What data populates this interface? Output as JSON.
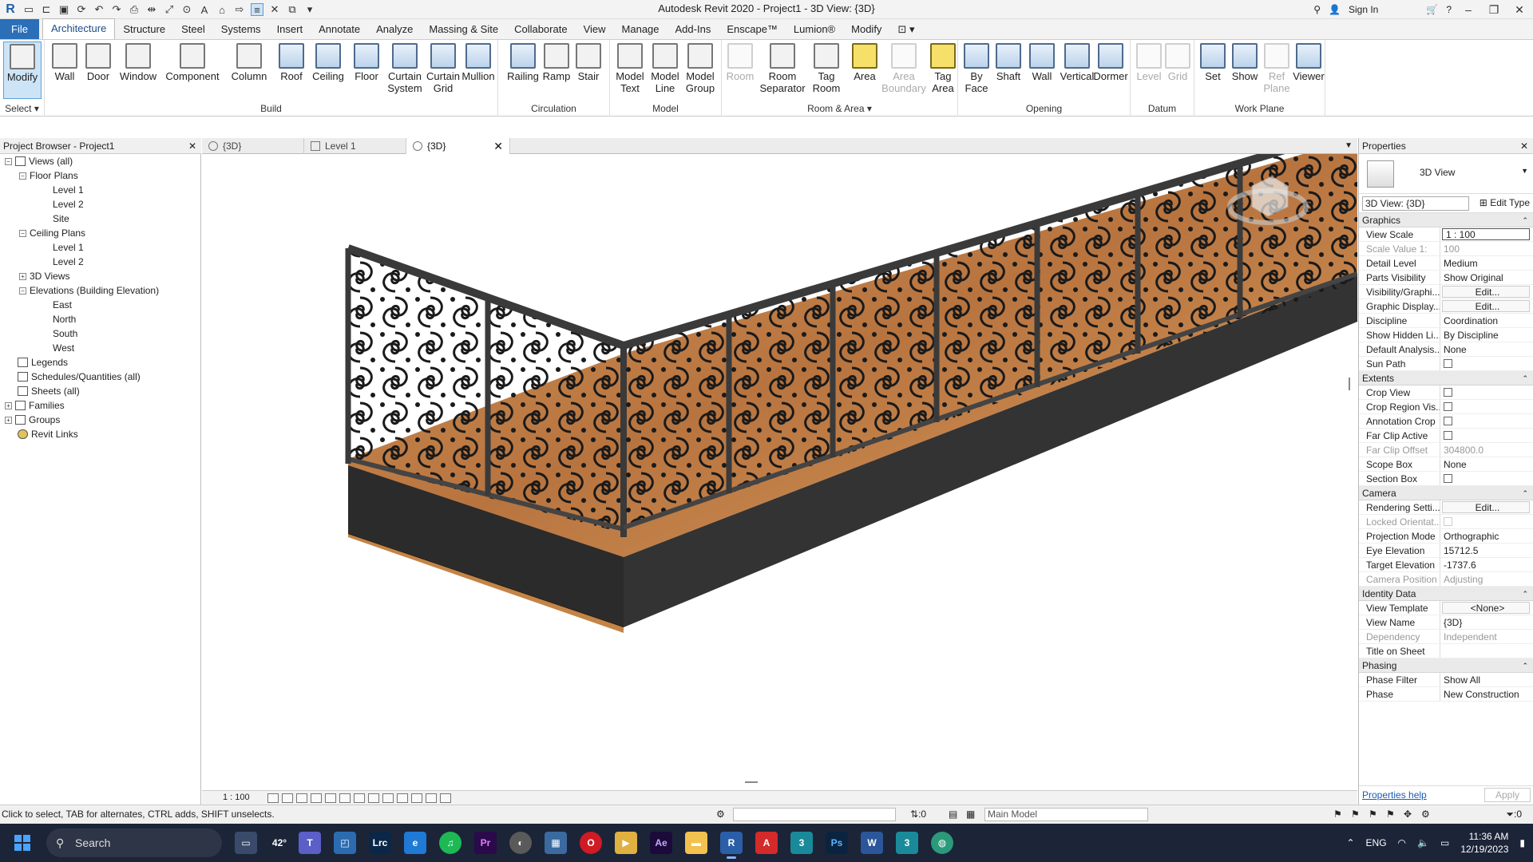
{
  "app": {
    "title": "Autodesk Revit 2020 - Project1 - 3D View: {3D}",
    "sign_in": "Sign In"
  },
  "ribbon_tabs": [
    "File",
    "Architecture",
    "Structure",
    "Steel",
    "Systems",
    "Insert",
    "Annotate",
    "Analyze",
    "Massing & Site",
    "Collaborate",
    "View",
    "Manage",
    "Add-Ins",
    "Enscape™",
    "Lumion®",
    "Modify"
  ],
  "ribbon": {
    "select_panel": {
      "title": "Select",
      "buttons": [
        "Modify"
      ]
    },
    "build_panel": {
      "title": "Build",
      "buttons": [
        "Wall",
        "Door",
        "Window",
        "Component",
        "Column",
        "Roof",
        "Ceiling",
        "Floor",
        "Curtain System",
        "Curtain Grid",
        "Mullion"
      ]
    },
    "circulation_panel": {
      "title": "Circulation",
      "buttons": [
        "Railing",
        "Ramp",
        "Stair"
      ]
    },
    "model_panel": {
      "title": "Model",
      "buttons": [
        "Model Text",
        "Model Line",
        "Model Group"
      ]
    },
    "room_panel": {
      "title": "Room & Area",
      "buttons": [
        "Room",
        "Room Separator",
        "Tag Room",
        "Area",
        "Area Boundary",
        "Tag Area"
      ]
    },
    "opening_panel": {
      "title": "Opening",
      "buttons": [
        "By Face",
        "Shaft",
        "Wall",
        "Vertical",
        "Dormer"
      ]
    },
    "datum_panel": {
      "title": "Datum",
      "buttons": [
        "Level",
        "Grid"
      ]
    },
    "workplane_panel": {
      "title": "Work Plane",
      "buttons": [
        "Set",
        "Show",
        "Ref Plane",
        "Viewer"
      ]
    }
  },
  "project_browser": {
    "title": "Project Browser - Project1",
    "items": [
      "Views (all)",
      "Floor Plans",
      "Level 1",
      "Level 2",
      "Site",
      "Ceiling Plans",
      "Level 1",
      "Level 2",
      "3D Views",
      "Elevations (Building Elevation)",
      "East",
      "North",
      "South",
      "West",
      "Legends",
      "Schedules/Quantities (all)",
      "Sheets (all)",
      "Families",
      "Groups",
      "Revit Links"
    ]
  },
  "view_tabs": [
    {
      "label": "{3D}"
    },
    {
      "label": "Level 1"
    },
    {
      "label": "{3D}"
    }
  ],
  "view_bar": {
    "scale": "1 : 100"
  },
  "properties": {
    "title": "Properties",
    "type_name": "3D View",
    "instance": "3D View: {3D}",
    "edit_type": "Edit Type",
    "groups": [
      {
        "name": "Graphics",
        "rows": [
          {
            "k": "View Scale",
            "v": "1 : 100"
          },
          {
            "k": "Scale Value 1:",
            "v": "100"
          },
          {
            "k": "Detail Level",
            "v": "Medium"
          },
          {
            "k": "Parts Visibility",
            "v": "Show Original"
          },
          {
            "k": "Visibility/Graphi...",
            "v": "Edit..."
          },
          {
            "k": "Graphic Display...",
            "v": "Edit..."
          },
          {
            "k": "Discipline",
            "v": "Coordination"
          },
          {
            "k": "Show Hidden Li...",
            "v": "By Discipline"
          },
          {
            "k": "Default Analysis...",
            "v": "None"
          },
          {
            "k": "Sun Path",
            "v": ""
          }
        ]
      },
      {
        "name": "Extents",
        "rows": [
          {
            "k": "Crop View",
            "v": ""
          },
          {
            "k": "Crop Region Vis...",
            "v": ""
          },
          {
            "k": "Annotation Crop",
            "v": ""
          },
          {
            "k": "Far Clip Active",
            "v": ""
          },
          {
            "k": "Far Clip Offset",
            "v": "304800.0"
          },
          {
            "k": "Scope Box",
            "v": "None"
          },
          {
            "k": "Section Box",
            "v": ""
          }
        ]
      },
      {
        "name": "Camera",
        "rows": [
          {
            "k": "Rendering Setti...",
            "v": "Edit..."
          },
          {
            "k": "Locked Orientat...",
            "v": ""
          },
          {
            "k": "Projection Mode",
            "v": "Orthographic"
          },
          {
            "k": "Eye Elevation",
            "v": "15712.5"
          },
          {
            "k": "Target Elevation",
            "v": "-1737.6"
          },
          {
            "k": "Camera Position",
            "v": "Adjusting"
          }
        ]
      },
      {
        "name": "Identity Data",
        "rows": [
          {
            "k": "View Template",
            "v": "<None>"
          },
          {
            "k": "View Name",
            "v": "{3D}"
          },
          {
            "k": "Dependency",
            "v": "Independent"
          },
          {
            "k": "Title on Sheet",
            "v": ""
          }
        ]
      },
      {
        "name": "Phasing",
        "rows": [
          {
            "k": "Phase Filter",
            "v": "Show All"
          },
          {
            "k": "Phase",
            "v": "New Construction"
          }
        ]
      }
    ],
    "help": "Properties help",
    "apply": "Apply"
  },
  "status": {
    "message": "Click to select, TAB for alternates, CTRL adds, SHIFT unselects.",
    "zero": ":0",
    "model": "Main Model",
    "filter": ":0"
  },
  "taskbar": {
    "search": "Search",
    "lang": "ENG",
    "time": "11:36 AM",
    "date": "12/19/2023",
    "weather": "42°"
  },
  "colors": {
    "accent": "#2a6fb8",
    "wood": "#c98a4e",
    "metal": "#4a4a4a"
  }
}
